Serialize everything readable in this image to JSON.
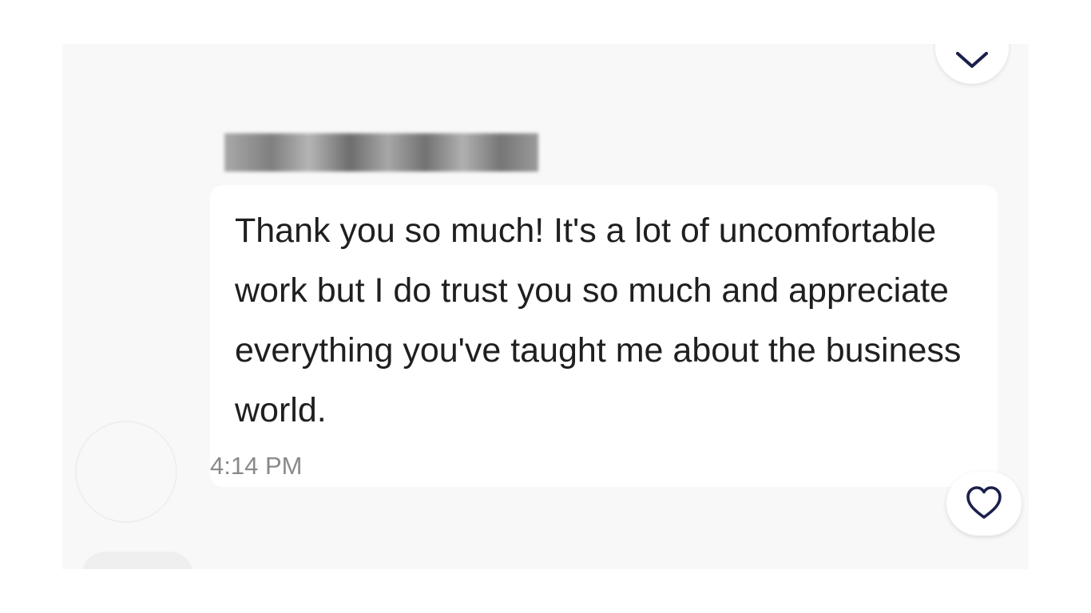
{
  "message": {
    "sender_name": "",
    "text": "Thank you so much! It's a lot of uncomfortable work but I do trust you so much and appreciate everything you've taught me about the business world.",
    "time": "4:14 PM"
  },
  "icons": {
    "top_button": "chevron-down-icon",
    "like_button": "heart-outline-icon"
  },
  "colors": {
    "panel_background": "#f8f8f8",
    "bubble_background": "#ffffff",
    "icon_navy": "#1b1f4b",
    "timestamp_gray": "#8a8a8a"
  }
}
